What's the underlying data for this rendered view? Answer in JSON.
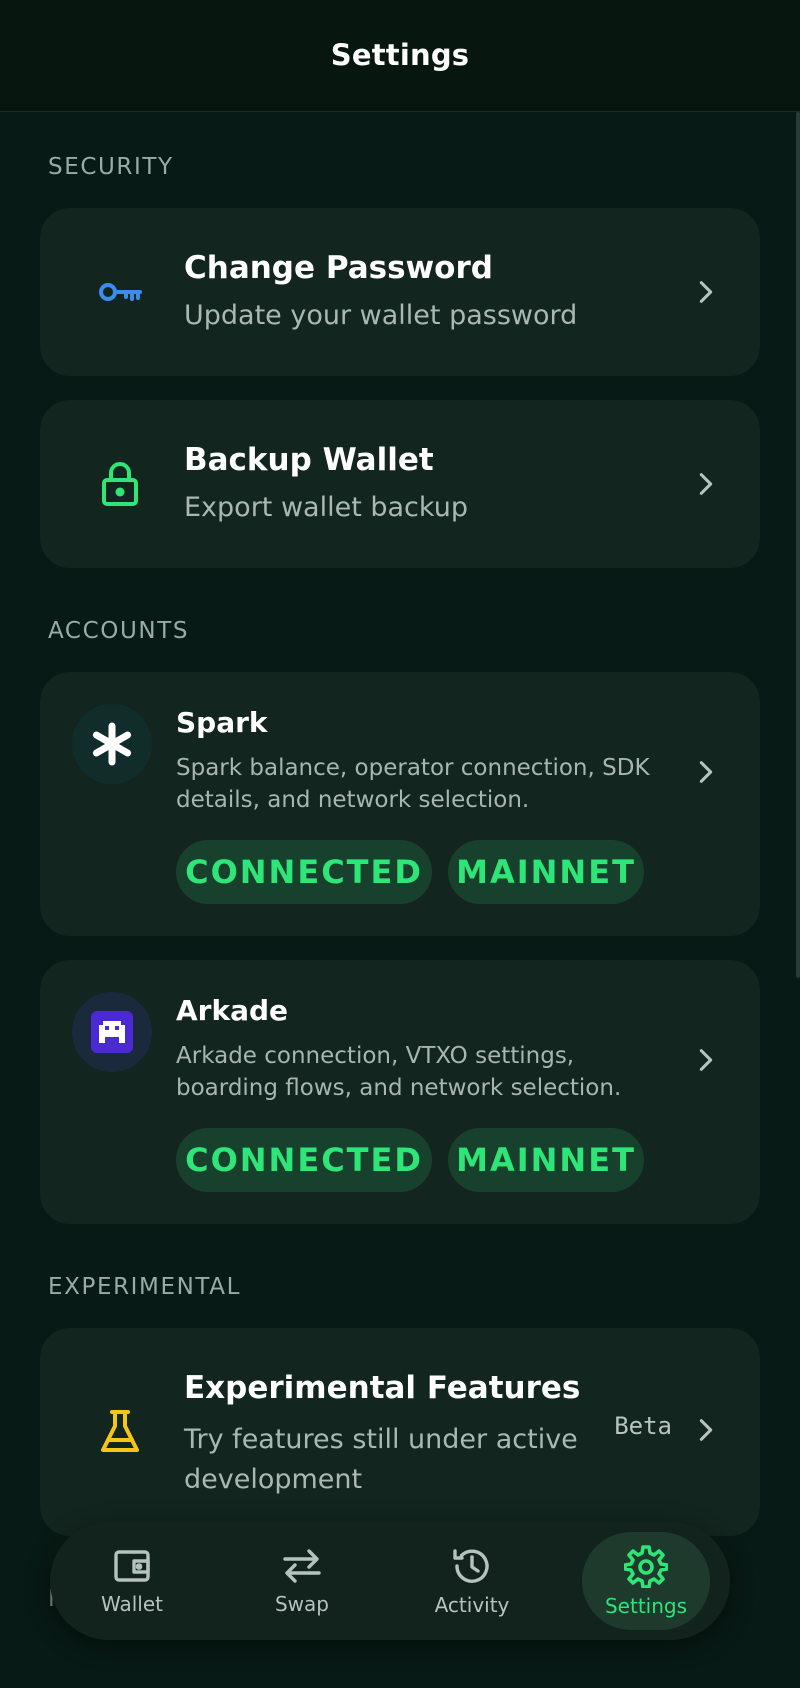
{
  "header": {
    "title": "Settings"
  },
  "sections": {
    "security": "SECURITY",
    "accounts": "ACCOUNTS",
    "experimental": "EXPERIMENTAL",
    "next_peek": "N"
  },
  "security_items": [
    {
      "title": "Change Password",
      "subtitle": "Update your wallet password",
      "icon": "key-icon"
    },
    {
      "title": "Backup Wallet",
      "subtitle": "Export wallet backup",
      "icon": "lock-icon"
    }
  ],
  "accounts": [
    {
      "name": "Spark",
      "description": "Spark balance, operator connection, SDK details, and network selection.",
      "status": "CONNECTED",
      "network": "MAINNET",
      "icon": "spark-asterisk-icon"
    },
    {
      "name": "Arkade",
      "description": "Arkade connection, VTXO settings, boarding flows, and network selection.",
      "status": "CONNECTED",
      "network": "MAINNET",
      "icon": "arkade-invader-icon"
    }
  ],
  "experimental": {
    "title": "Experimental Features",
    "subtitle_line1": "Try features still under active",
    "subtitle_line2": "development",
    "tag": "Beta",
    "icon": "flask-icon"
  },
  "nav": {
    "items": [
      {
        "label": "Wallet",
        "icon": "wallet-icon"
      },
      {
        "label": "Swap",
        "icon": "swap-arrows-icon"
      },
      {
        "label": "Activity",
        "icon": "history-icon"
      },
      {
        "label": "Settings",
        "icon": "gear-icon"
      }
    ],
    "active_index": 3
  },
  "colors": {
    "background": "#081a15",
    "card": "#13251f",
    "accent_green": "#2ee577",
    "key_blue": "#3b8cf0",
    "flask_yellow": "#f5c518"
  }
}
